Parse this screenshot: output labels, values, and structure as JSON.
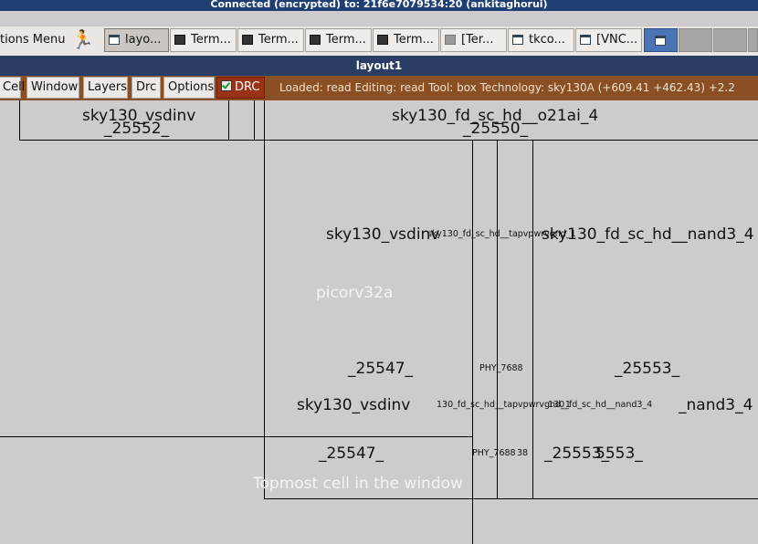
{
  "vnc": {
    "title": "Connected (encrypted) to: 21f6e7079534:20 (ankitaghorui)"
  },
  "taskbar": {
    "apps_menu_label": "tions Menu",
    "tasks": [
      {
        "label": "layo...",
        "icon": "window-icon",
        "active": true
      },
      {
        "label": "Term...",
        "icon": "terminal-icon"
      },
      {
        "label": "Term...",
        "icon": "terminal-icon"
      },
      {
        "label": "Term...",
        "icon": "terminal-icon"
      },
      {
        "label": "Term...",
        "icon": "terminal-icon"
      },
      {
        "label": "[Ter...",
        "icon": "terminal-icon"
      },
      {
        "label": "tkco...",
        "icon": "window-icon"
      },
      {
        "label": "[VNC...",
        "icon": "window-icon"
      }
    ]
  },
  "window": {
    "title": "layout1"
  },
  "menubar": {
    "items": [
      "Cell",
      "Window",
      "Layers",
      "Drc",
      "Options"
    ],
    "drc_label": "DRC",
    "status": "Loaded: read  Editing: read  Tool: box   Technology: sky130A     (+609.41 +462.43) +2.2"
  },
  "canvas": {
    "labels": {
      "vsdinv_top": "sky130_vsdinv",
      "c25552": "_25552_",
      "o21ai": "sky130_fd_sc_hd__o21ai_4",
      "c25550": "_25550_",
      "vsdinv_mid": "sky130_vsdinv",
      "tapvpwrvgnd": "sky130_fd_sc_hd__tapvpwrvgnd_1",
      "nand3_a": "sky130_fd_sc_hd__nand3_4",
      "picorv32a": "picorv32a",
      "c25547_a": "_25547_",
      "phy_a": "PHY_7688",
      "c25553_a": "_25553_",
      "vsdinv_low": "sky130_vsdinv",
      "tap_low": "130_fd_sc_hd__tapvpwrvgnd_1",
      "nand3_small": "130_fd_sc_hd__nand3_4",
      "nand3_b": "_nand3_4",
      "c25547_b": "_25547_",
      "phy_b": "PHY_7688",
      "phy_b_suffix": "38",
      "c25553_b": "_25553_",
      "c25553_c": "5553_",
      "topmost": "Topmost cell in the window"
    }
  }
}
